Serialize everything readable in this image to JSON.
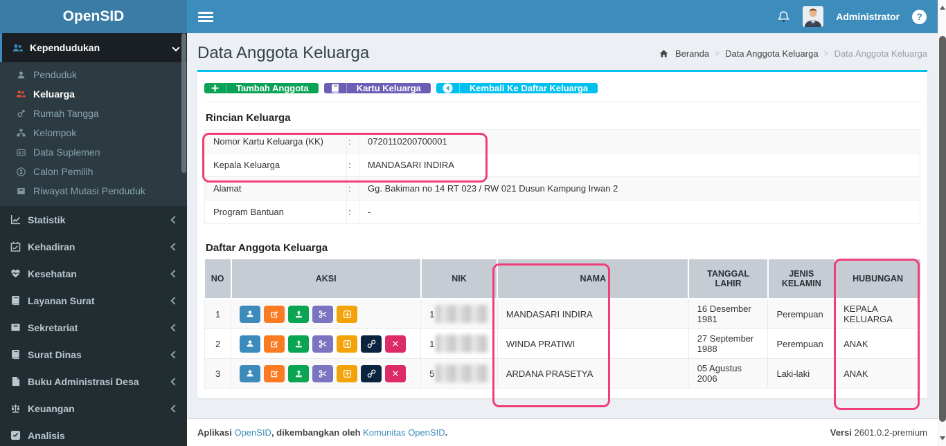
{
  "app": {
    "name": "OpenSID"
  },
  "navbar": {
    "user": "Administrator",
    "help": "?"
  },
  "sidebar": {
    "parent_active": {
      "label": "Kependudukan",
      "icon": "users-icon"
    },
    "submenu": [
      {
        "label": "Penduduk",
        "icon": "person-icon"
      },
      {
        "label": "Keluarga",
        "icon": "users-icon",
        "active": true
      },
      {
        "label": "Rumah Tangga",
        "icon": "gender-icon"
      },
      {
        "label": "Kelompok",
        "icon": "sitemap-icon"
      },
      {
        "label": "Data Suplemen",
        "icon": "id-card-icon"
      },
      {
        "label": "Calon Pemilih",
        "icon": "street-view-icon"
      },
      {
        "label": "Riwayat Mutasi Penduduk",
        "icon": "archive-icon"
      }
    ],
    "items": [
      {
        "label": "Statistik",
        "icon": "chart-icon"
      },
      {
        "label": "Kehadiran",
        "icon": "calendar-icon"
      },
      {
        "label": "Kesehatan",
        "icon": "heart-icon"
      },
      {
        "label": "Layanan Surat",
        "icon": "book-icon"
      },
      {
        "label": "Sekretariat",
        "icon": "box-icon"
      },
      {
        "label": "Surat Dinas",
        "icon": "book-icon"
      },
      {
        "label": "Buku Administrasi Desa",
        "icon": "file-icon"
      },
      {
        "label": "Keuangan",
        "icon": "scale-icon"
      },
      {
        "label": "Analisis",
        "icon": "check-square-icon"
      }
    ]
  },
  "page": {
    "title": "Data Anggota Keluarga"
  },
  "breadcrumb": {
    "home": "Beranda",
    "level1": "Data Anggota Keluarga",
    "current": "Data Anggota Keluarga"
  },
  "toolbar": {
    "add_label": "Tambah Anggota",
    "card_label": "Kartu Keluarga",
    "back_label": "Kembali Ke Daftar Keluarga"
  },
  "rincian": {
    "heading": "Rincian Keluarga",
    "colon": ":",
    "rows": [
      {
        "label": "Nomor Kartu Keluarga (KK)",
        "value": "0720110200700001"
      },
      {
        "label": "Kepala Keluarga",
        "value": "MANDASARI INDIRA"
      },
      {
        "label": "Alamat",
        "value": "Gg. Bakiman no 14 RT 023 / RW 021 Dusun Kampung Irwan 2"
      },
      {
        "label": "Program Bantuan",
        "value": "-"
      }
    ]
  },
  "anggota": {
    "heading": "Daftar Anggota Keluarga",
    "columns": {
      "no": "NO",
      "aksi": "AKSI",
      "nik": "NIK",
      "nama": "NAMA",
      "tanggal_lahir": "TANGGAL LAHIR",
      "jenis_kelamin": "JENIS KELAMIN",
      "hubungan": "HUBUNGAN"
    },
    "rows": [
      {
        "no": "1",
        "nik_prefix": "1",
        "nik_redacted": true,
        "nama": "MANDASARI INDIRA",
        "tanggal_lahir": "16 Desember 1981",
        "jenis_kelamin": "Perempuan",
        "hubungan": "KEPALA KELUARGA"
      },
      {
        "no": "2",
        "nik_prefix": "1",
        "nik_redacted": true,
        "nama": "WINDA PRATIWI",
        "tanggal_lahir": "27 September 1988",
        "jenis_kelamin": "Perempuan",
        "hubungan": "ANAK"
      },
      {
        "no": "3",
        "nik_prefix": "5",
        "nik_redacted": true,
        "nama": "ARDANA PRASETYA",
        "tanggal_lahir": "05 Agustus 2006",
        "jenis_kelamin": "Laki-laki",
        "hubungan": "ANAK"
      }
    ]
  },
  "footer": {
    "prefix": "Aplikasi ",
    "link1": "OpenSID",
    "mid": ", dikembangkan oleh ",
    "link2": "Komunitas OpenSID",
    "suffix": ".",
    "version_label": "Versi",
    "version": " 2601.0.2-premium"
  },
  "colors": {
    "navbar": "#3c8dbc",
    "logo_bg": "#3a7ca6",
    "sidebar_bg": "#222d32",
    "card_top_border": "#00c0ef",
    "annotation": "#f03e78",
    "btn_add": "#0aa255",
    "btn_card": "#6a5fb5",
    "btn_back": "#00c0ef",
    "action_blue": "#3d8abd",
    "action_orange": "#fb7b23",
    "action_green": "#09a552",
    "action_purple": "#7b74c0",
    "action_amber": "#f2a30a",
    "action_navy": "#0b2440",
    "action_pink": "#dd2a68"
  }
}
